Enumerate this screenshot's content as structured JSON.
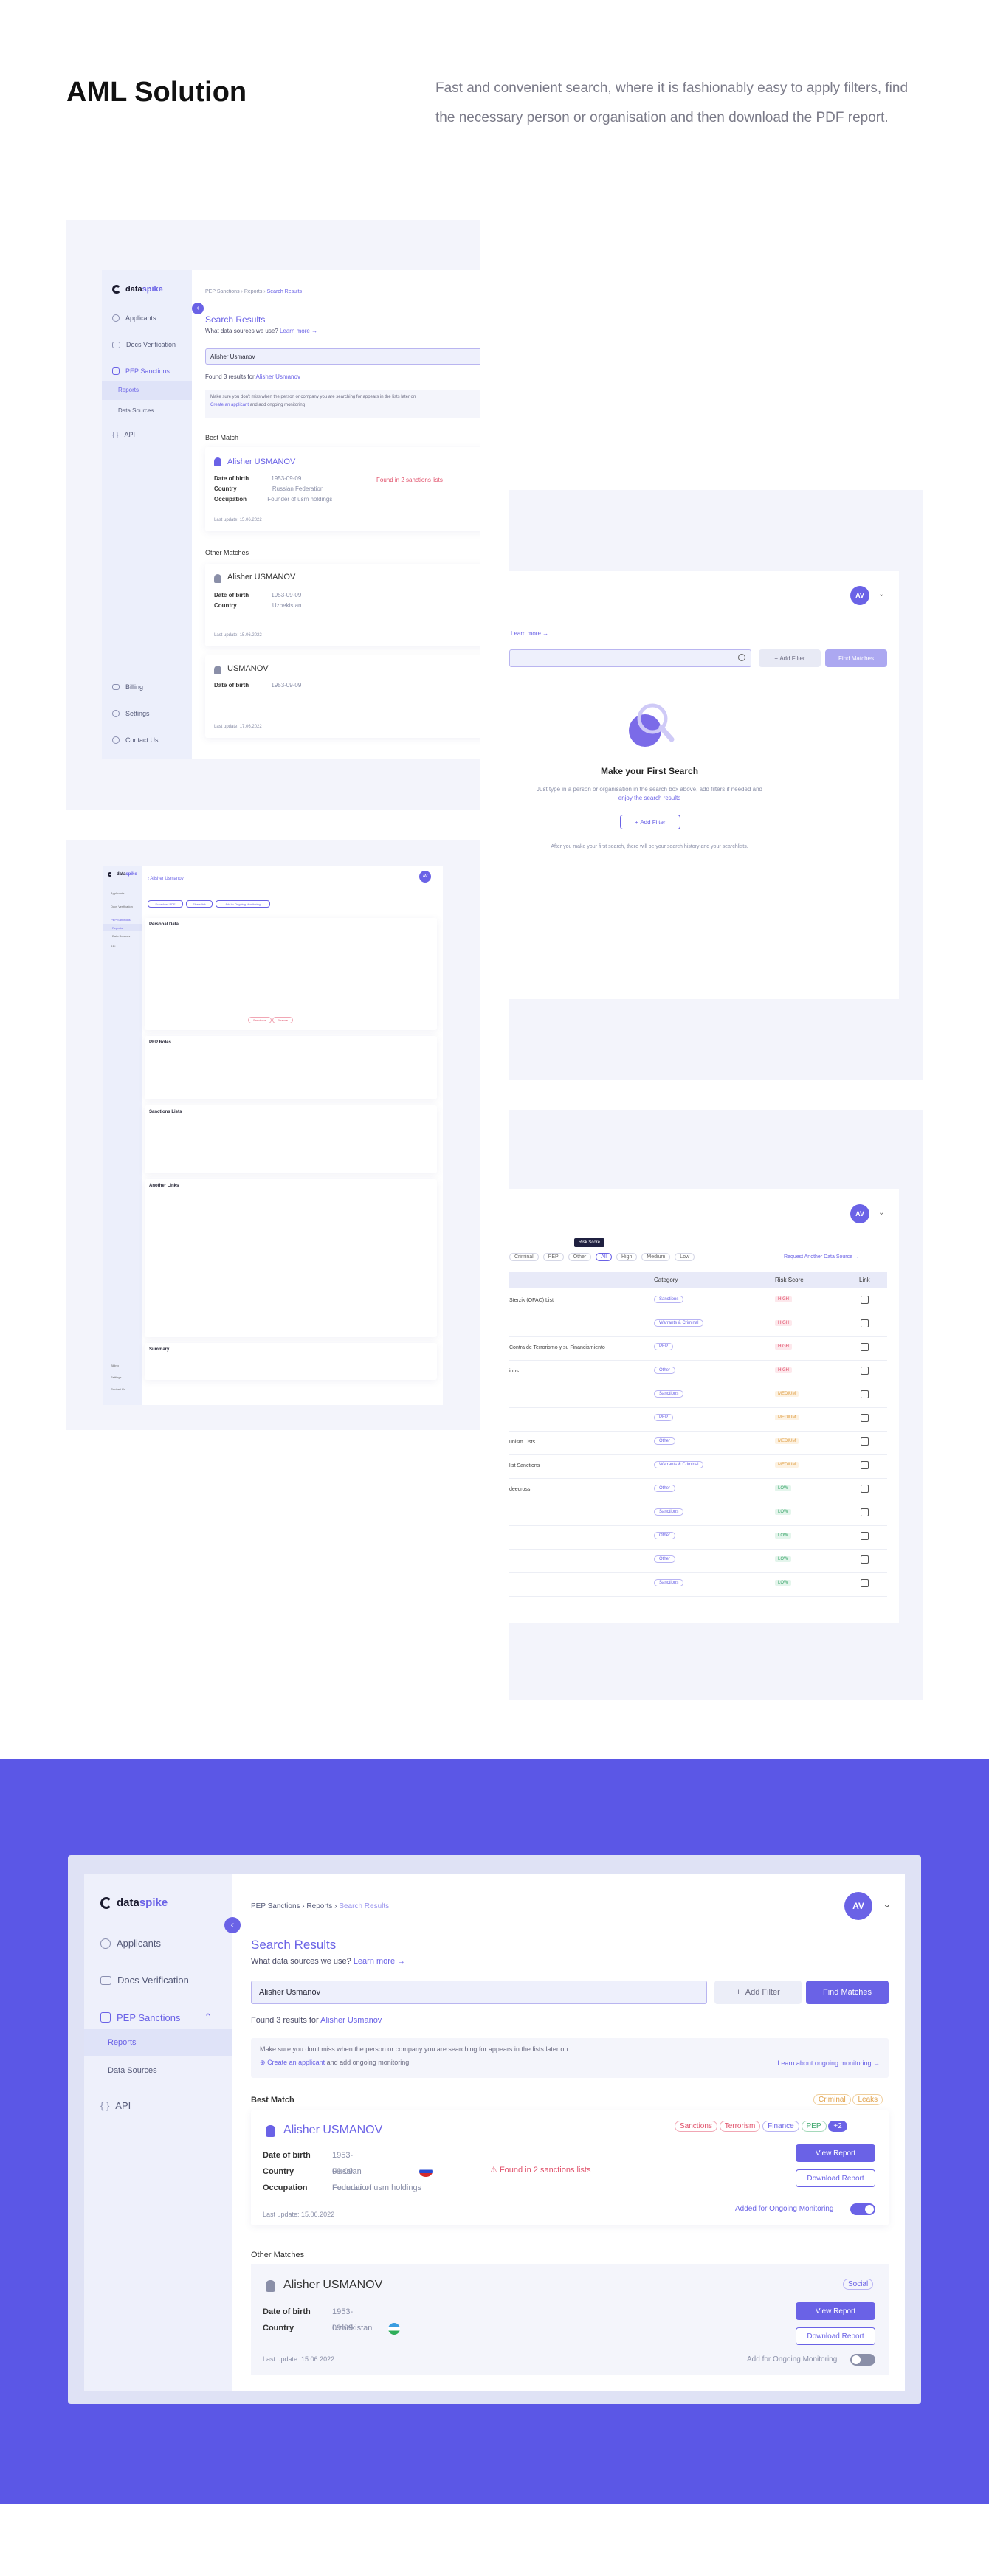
{
  "header": {
    "title": "AML Solution",
    "description": "Fast and convenient search, where it is fashionably easy to apply filters, find the necessary person or organisation and then download the PDF report."
  },
  "colors": {
    "accent": "#6a62e6",
    "bottom_band": "#5b57e6",
    "panel": "#f3f4fb"
  },
  "app": {
    "logo_a": "data",
    "logo_b": "spike",
    "nav": {
      "applicants": "Applicants",
      "docs": "Docs Verification",
      "pep": "PEP Sanctions",
      "reports": "Reports",
      "sources": "Data Sources",
      "api": "API",
      "billing": "Billing",
      "settings": "Settings",
      "contact": "Contact Us"
    },
    "avatar": "AV"
  },
  "search": {
    "breadcrumb": [
      "PEP Sanctions",
      "Reports",
      "Search Results"
    ],
    "title": "Search Results",
    "sources_q": "What data sources we use?",
    "learn_more": "Learn more",
    "query": "Alisher Usmanov",
    "add_filter": "Add Filter",
    "find": "Find Matches",
    "found_prefix": "Found 3 results for",
    "found_name": "Alisher Usmanov",
    "notice": "Make sure you don't miss when the person or company you are searching for appears in the lists later on",
    "notice_link": "Create an applicant",
    "notice_rest": "and add ongoing monitoring",
    "notice_right": "Learn about ongoing monitoring",
    "best_match": "Best Match",
    "other_matches": "Other Matches",
    "best": {
      "name": "Alisher USMANOV",
      "dob_label": "Date of birth",
      "dob": "1953-09-09",
      "country_label": "Country",
      "country": "Russian Federation",
      "occ_label": "Occupation",
      "occ": "Founder of usm holdings",
      "found_in": "Found in 2 sanctions lists",
      "last_update": "Last update: 15.06.2022",
      "tags": [
        "Sanctions",
        "Terrorism",
        "Finance",
        "PEP",
        "+2"
      ],
      "extra_tags": [
        "Criminal",
        "Leaks"
      ],
      "view": "View Report",
      "download": "Download Report",
      "monitor": "Added for Ongoing Monitoring"
    },
    "second": {
      "name": "Alisher USMANOV",
      "dob_label": "Date of birth",
      "dob": "1953-09-09",
      "country_label": "Country",
      "country": "Uzbekistan",
      "last_update": "Last update: 15.06.2022",
      "tag": "Social",
      "view": "View Report",
      "download": "Download Report",
      "monitor": "Add for Ongoing Monitoring"
    },
    "third": {
      "name": "USMANOV",
      "dob_label": "Date of birth",
      "dob": "1953-09-09",
      "last_update": "Last update: 17.06.2022"
    }
  },
  "empty": {
    "learn_more": "Learn more",
    "add_filter": "Add Filter",
    "find": "Find Matches",
    "title": "Make your First Search",
    "desc_1": "Just type in a person or organisation in the search box above, add filters if needed and",
    "desc_2": "enjoy the search results",
    "btn": "Add Filter",
    "after": "After you make your first search, there will be your search history and your searchlists."
  },
  "table": {
    "tooltip": "Risk Score",
    "filters": [
      "Criminal",
      "PEP",
      "Other",
      "All",
      "High",
      "Medium",
      "Low"
    ],
    "request": "Request Another Data Source",
    "headers": [
      "Category",
      "Risk Score",
      "Link"
    ],
    "rows": [
      {
        "name": "Sterzik (OFAC) List",
        "cat": "Sanctions",
        "risk": "HIGH"
      },
      {
        "name": "",
        "cat": "Warrants & Criminal",
        "risk": "HIGH"
      },
      {
        "name": "Contra de Terrorismo y su Financiamiento",
        "cat": "PEP",
        "risk": "HIGH"
      },
      {
        "name": "ions",
        "cat": "Other",
        "risk": "HIGH"
      },
      {
        "name": "",
        "cat": "Sanctions",
        "risk": "MEDIUM"
      },
      {
        "name": "",
        "cat": "PEP",
        "risk": "MEDIUM"
      },
      {
        "name": "unism Lists",
        "cat": "Other",
        "risk": "MEDIUM"
      },
      {
        "name": "list Sanctions",
        "cat": "Warrants & Criminal",
        "risk": "MEDIUM"
      },
      {
        "name": "deecross",
        "cat": "Other",
        "risk": "LOW"
      },
      {
        "name": "",
        "cat": "Sanctions",
        "risk": "LOW"
      },
      {
        "name": "",
        "cat": "Other",
        "risk": "LOW"
      },
      {
        "name": "",
        "cat": "Other",
        "risk": "LOW"
      },
      {
        "name": "",
        "cat": "Sanctions",
        "risk": "LOW"
      }
    ]
  },
  "report": {
    "back_name": "Alisher Usmanov",
    "btn_pdf": "Download PDF",
    "btn_share": "Share link",
    "btn_monitor": "Add to Ongoing Monitoring",
    "sections": [
      "Personal Data",
      "PEP Roles",
      "Sanctions Lists",
      "Another Links",
      "Summary"
    ],
    "tags": [
      "Sanctions",
      "Finance"
    ]
  }
}
